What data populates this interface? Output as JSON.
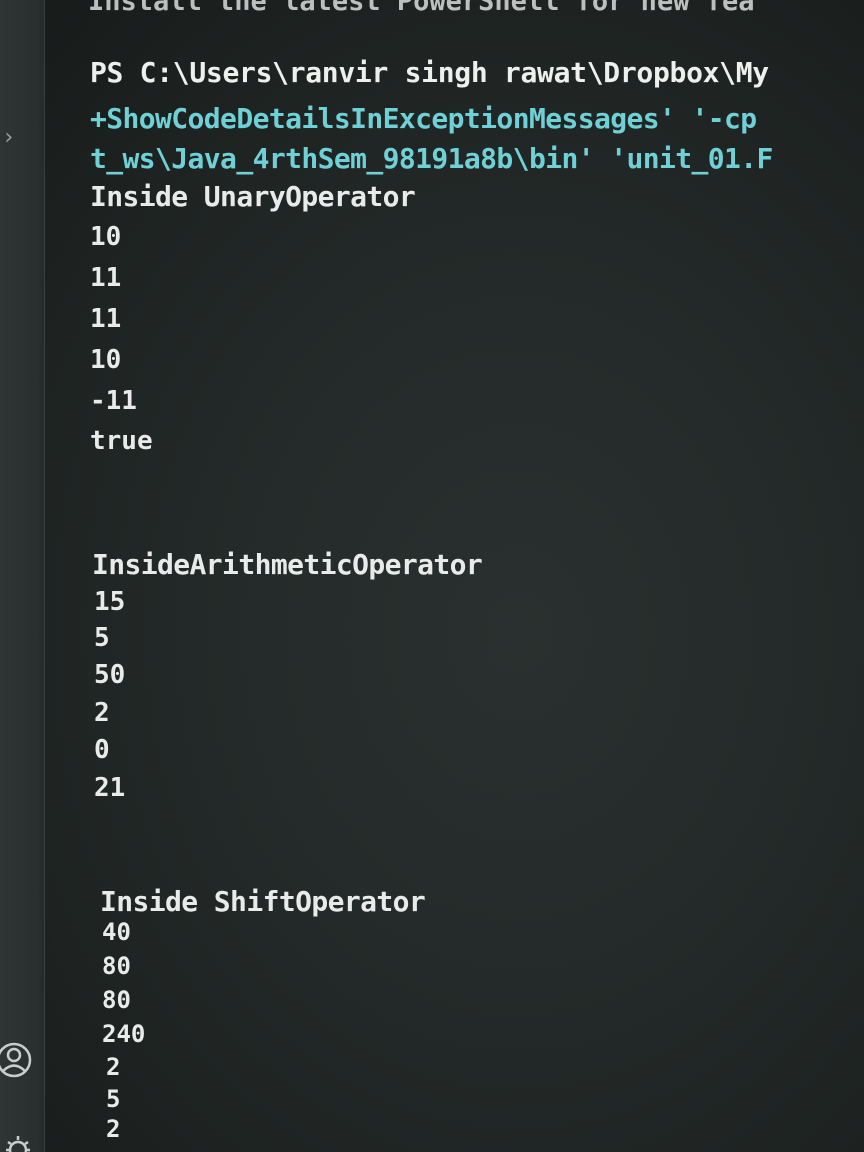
{
  "terminal": {
    "partial_top_text": "Install the latest PowerShell for new fea",
    "prompt_line": "PS C:\\Users\\ranvir singh rawat\\Dropbox\\My",
    "command_lines": [
      "+ShowCodeDetailsInExceptionMessages' '-cp",
      "t_ws\\Java_4rthSem_98191a8b\\bin' 'unit_01.F"
    ],
    "sections": [
      {
        "title": "Inside UnaryOperator",
        "values": [
          "10",
          "11",
          "11",
          "10",
          "-11",
          "true"
        ]
      },
      {
        "title": "InsideArithmeticOperator",
        "values": [
          "15",
          "5",
          "50",
          "2",
          "0",
          "21"
        ]
      },
      {
        "title": "Inside ShiftOperator",
        "values": [
          "40",
          "80",
          "80",
          "240",
          "2",
          "5",
          "2"
        ]
      }
    ]
  },
  "sidebar": {
    "icons": [
      "chevron-right-icon",
      "account-icon",
      "gear-icon"
    ]
  },
  "colors": {
    "background": "#1f2524",
    "output_text": "#e8ebe9",
    "command_text": "#6fd1d6"
  }
}
